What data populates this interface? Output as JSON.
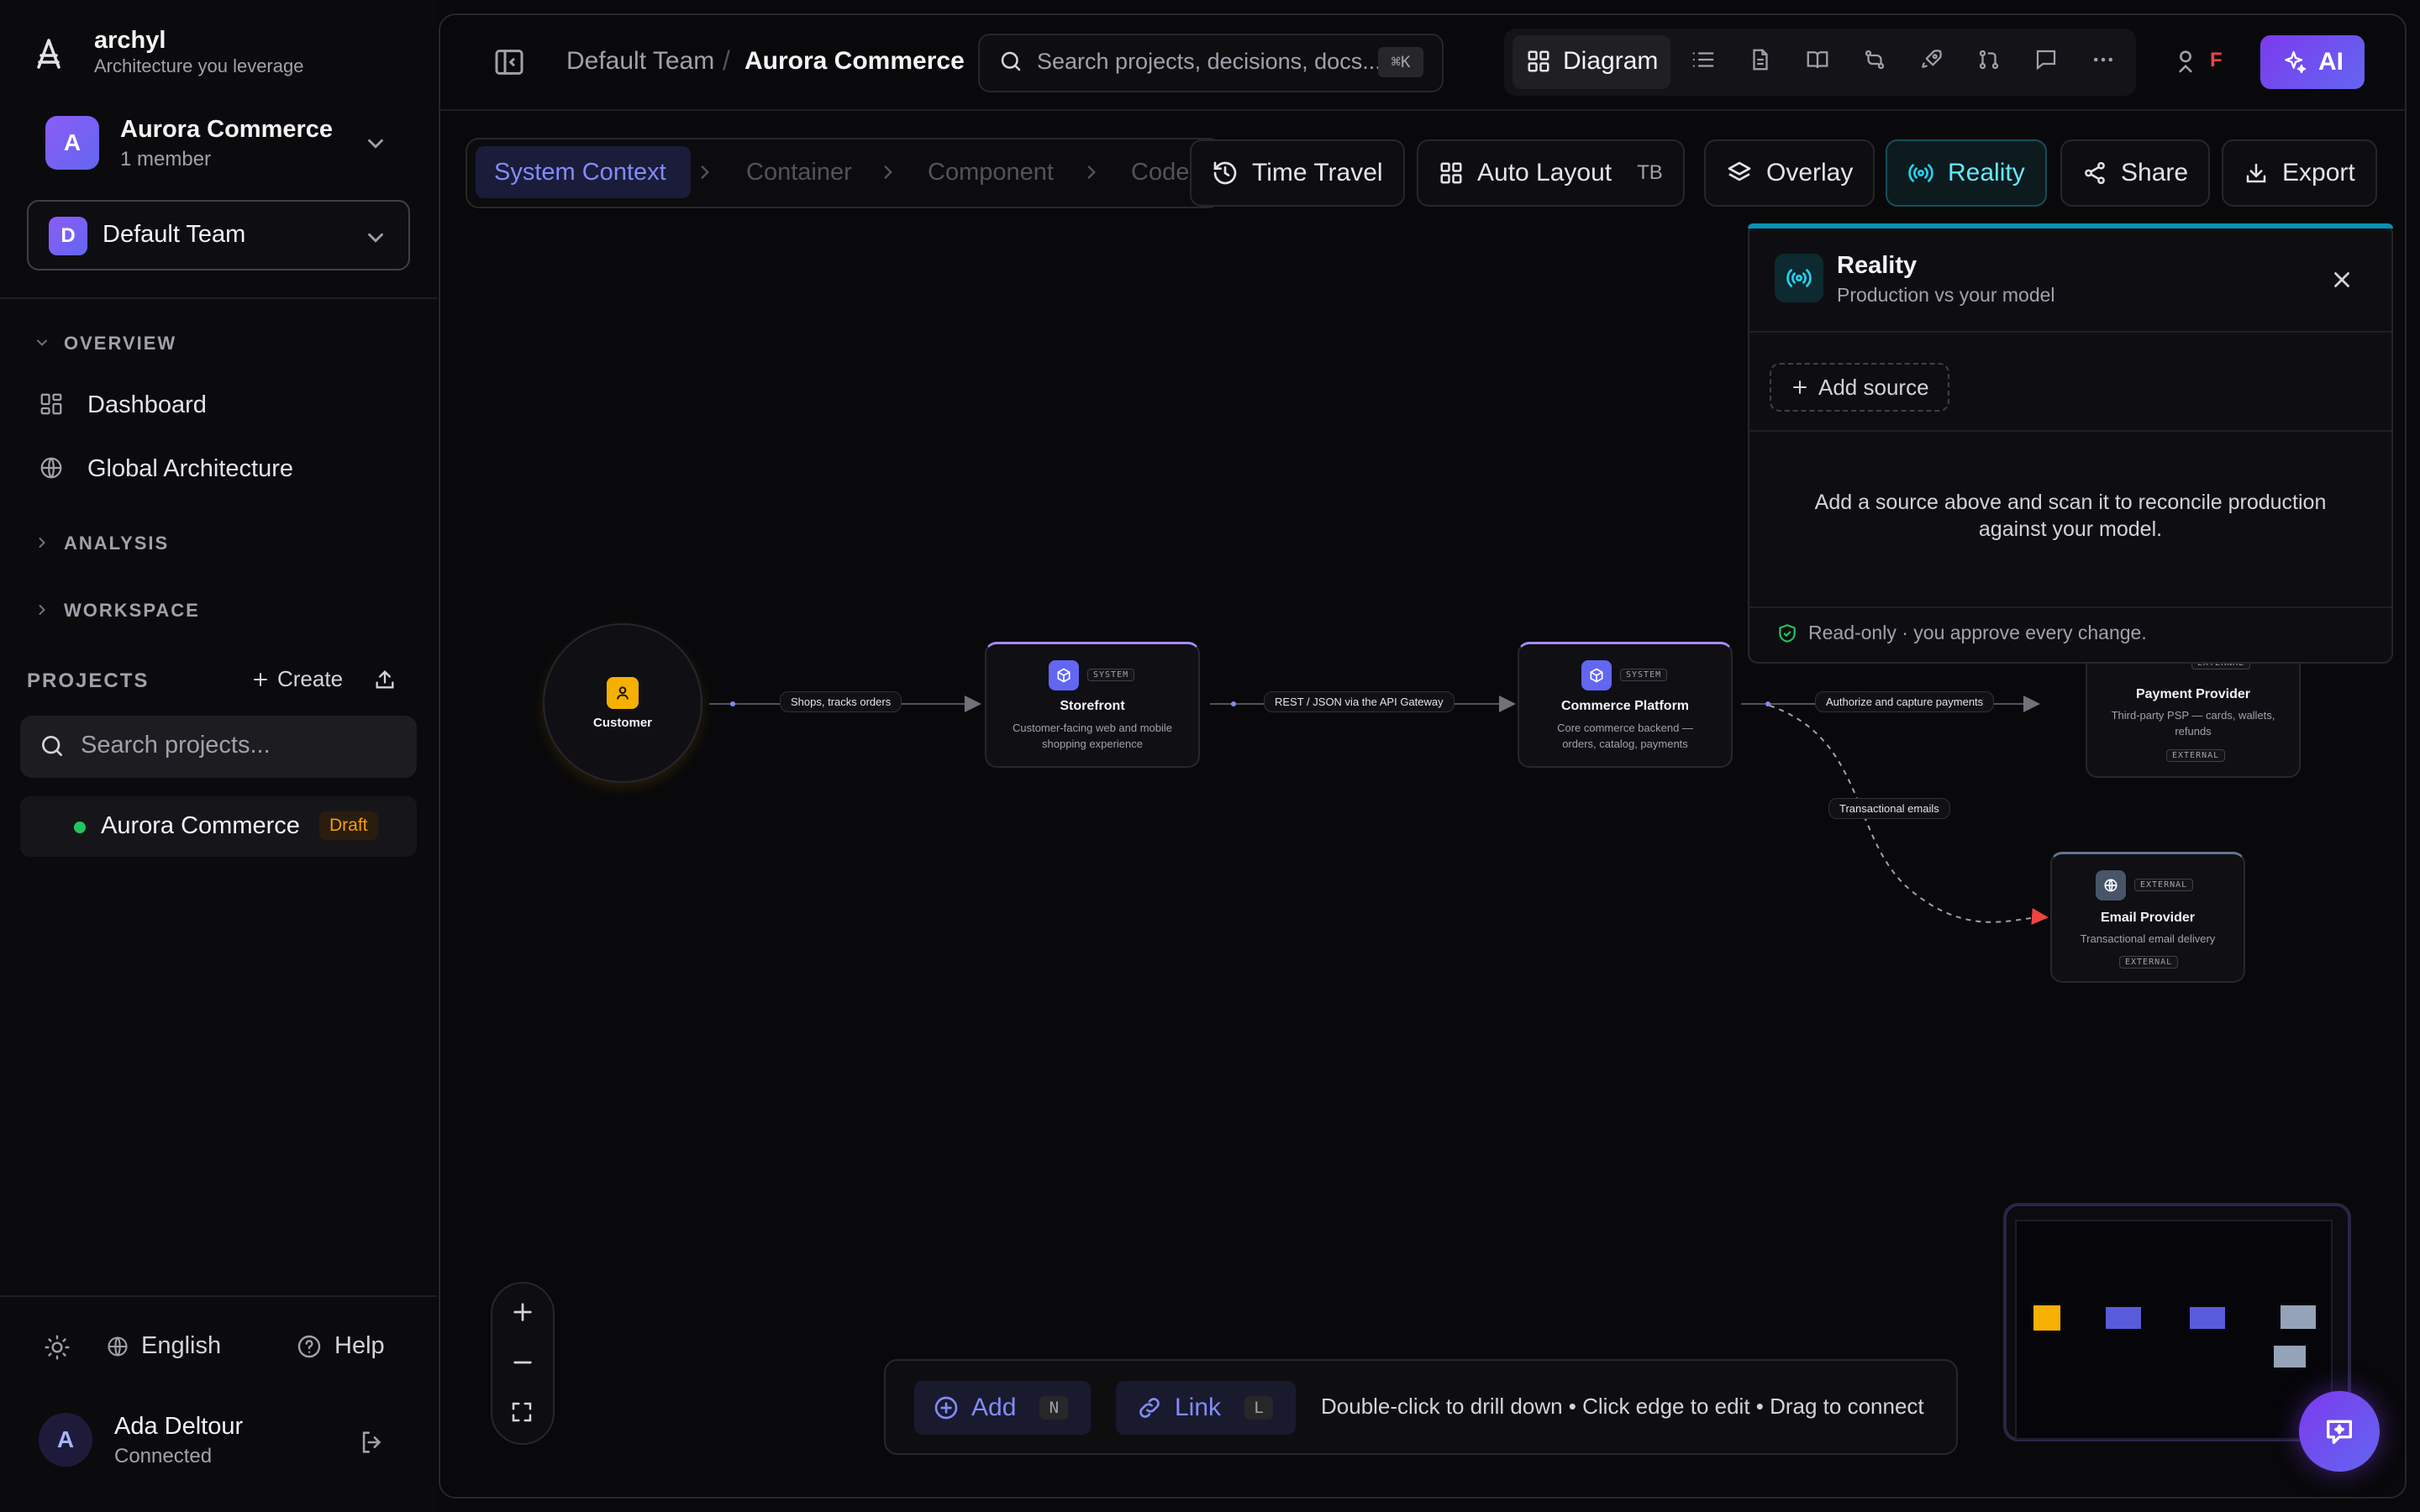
{
  "brand": {
    "name": "archyl",
    "tagline": "Architecture you leverage"
  },
  "project": {
    "avatar": "A",
    "name": "Aurora Commerce",
    "members": "1 member"
  },
  "team": {
    "avatar": "D",
    "name": "Default Team"
  },
  "sidebar": {
    "overview": "OVERVIEW",
    "nav": [
      {
        "label": "Dashboard",
        "icon": "grid-icon"
      },
      {
        "label": "Global Architecture",
        "icon": "globe-icon"
      }
    ],
    "analysis": "ANALYSIS",
    "workspace": "WORKSPACE",
    "projects_head": "PROJECTS",
    "create": "Create",
    "search_placeholder": "Search projects...",
    "project_item": {
      "name": "Aurora Commerce",
      "badge": "Draft"
    },
    "language": "English",
    "help": "Help"
  },
  "user": {
    "avatar": "A",
    "name": "Ada Deltour",
    "status": "Connected"
  },
  "topbar": {
    "breadcrumb_team": "Default Team",
    "breadcrumb_sep": "/",
    "breadcrumb_project": "Aurora Commerce",
    "search_placeholder": "Search projects, decisions, docs...",
    "search_shortcut": "⌘K",
    "active_view": "Diagram",
    "presence_initial": "F",
    "ai": "AI"
  },
  "levels": [
    "System Context",
    "Container",
    "Component",
    "Code"
  ],
  "toolbar": {
    "time_travel": "Time Travel",
    "auto_layout": "Auto Layout",
    "layout_dir": "TB",
    "overlay": "Overlay",
    "reality": "Reality",
    "share": "Share",
    "export": "Export"
  },
  "diagram": {
    "nodes": {
      "customer": {
        "title": "Customer"
      },
      "storefront": {
        "tag": "SYSTEM",
        "title": "Storefront",
        "desc1": "Customer-facing web and mobile",
        "desc2": "shopping experience"
      },
      "platform": {
        "tag": "SYSTEM",
        "title": "Commerce Platform",
        "desc1": "Core commerce backend —",
        "desc2": "orders, catalog, payments"
      },
      "payment": {
        "tag": "EXTERNAL",
        "title": "Payment Provider",
        "desc1": "Third-party PSP — cards, wallets,",
        "desc2": "refunds",
        "badge": "EXTERNAL"
      },
      "email": {
        "tag": "EXTERNAL",
        "title": "Email Provider",
        "desc1": "Transactional email delivery",
        "badge": "EXTERNAL"
      }
    },
    "edges": {
      "e1": "Shops, tracks orders",
      "e2": "REST / JSON via the API Gateway",
      "e3": "Authorize and capture payments",
      "e4": "Transactional emails"
    }
  },
  "reality_panel": {
    "title": "Reality",
    "subtitle": "Production vs your model",
    "add_source": "Add source",
    "empty_line1": "Add a source above and scan it to reconcile production",
    "empty_line2": "against your model.",
    "footer": "Read-only · you approve every change."
  },
  "hintbar": {
    "add": "Add",
    "add_key": "N",
    "link": "Link",
    "link_key": "L",
    "hint": "Double-click to drill down • Click edge to edit • Drag to connect"
  },
  "colors": {
    "accent": "#6366f1",
    "reality": "#22d3ee",
    "customer": "#f5b000",
    "external": "#94a3b8"
  }
}
